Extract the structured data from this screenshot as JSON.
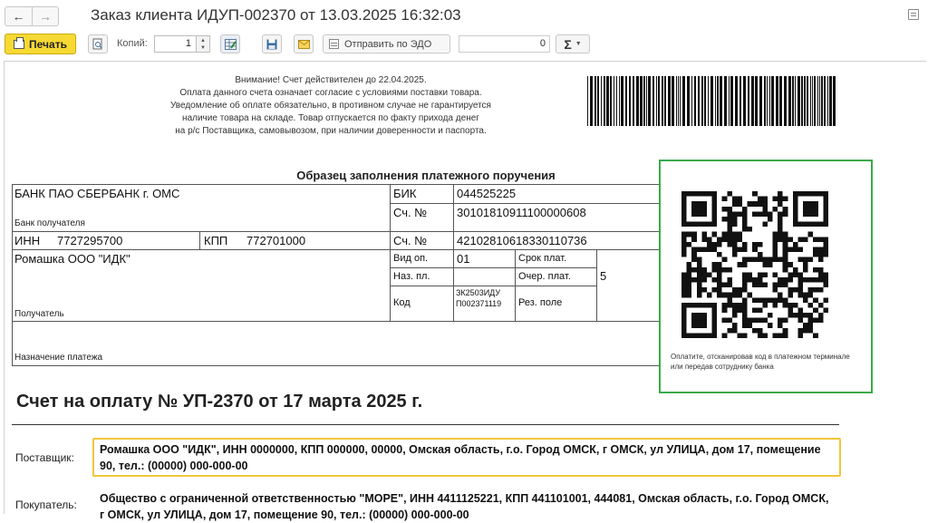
{
  "window": {
    "title": "Заказ клиента ИДУП-002370 от 13.03.2025 16:32:03"
  },
  "toolbar": {
    "print_label": "Печать",
    "copies_label": "Копий:",
    "copies_value": "1",
    "send_edo_label": "Отправить по ЭДО",
    "sum_value": "0",
    "sigma_label": "Σ"
  },
  "document": {
    "notice_lines": [
      "Внимание! Счет действителен до 22.04.2025.",
      "Оплата данного счета означает согласие с условиями поставки товара.",
      "Уведомление об оплате обязательно, в противном случае не гарантируется",
      "наличие товара на складе. Товар отпускается по факту прихода денег",
      "на р/с Поставщика, самовывозом, при наличии доверенности и паспорта."
    ],
    "payment_sample": {
      "title": "Образец заполнения платежного поручения",
      "bank_name": "БАНК ПАО СБЕРБАНК г. ОМС",
      "bank_label": "Банк получателя",
      "bik_label": "БИК",
      "bik": "044525225",
      "corr_label": "Сч. №",
      "corr_account": "30101810911100000608",
      "inn_label": "ИНН",
      "inn": "7727295700",
      "kpp_label": "КПП",
      "kpp": "772701000",
      "account_label": "Сч. №",
      "account": "42102810618330110736",
      "recipient_name": "Ромашка ООО \"ИДК\"",
      "recipient_label": "Получатель",
      "vid_op_label": "Вид оп.",
      "vid_op": "01",
      "srok_label": "Срок плат.",
      "naz_pl_label": "Наз. пл.",
      "ochered_label": "Очер. плат.",
      "ochered": "5",
      "kod_label": "Код",
      "kod": "ЗК2503ИДУ П002371119",
      "rez_label": "Рез. поле",
      "purpose_label": "Назначение платежа"
    },
    "qr_caption": "Оплатите, отсканировав код в платежном терминале или передав сотруднику банка",
    "invoice_title": "Счет на оплату № УП-2370 от 17 марта 2025 г.",
    "supplier_label": "Поставщик:",
    "supplier_text": "Ромашка ООО \"ИДК\", ИНН 0000000, КПП 000000, 00000, Омская область, г.о. Город ОМСК, г ОМСК, ул УЛИЦА, дом 17, помещение 90, тел.: (00000) 000-000-00",
    "buyer_label": "Покупатель:",
    "buyer_text": "Общество с ограниченной ответственностью \"МОРЕ\", ИНН 4411125221, КПП 441101001, 444081, Омская область, г.о. Город ОМСК, г ОМСК, ул УЛИЦА, дом 17, помещение 90, тел.: (00000) 000-000-00"
  },
  "colors": {
    "print_button": "#f6d932",
    "qr_frame": "#3aaa4a",
    "supplier_highlight": "#f2c63a"
  },
  "icons": {
    "back": "arrow-left-icon",
    "forward": "arrow-right-icon",
    "menu": "more-menu-icon",
    "printer": "printer-icon",
    "preview": "preview-icon",
    "edit": "edit-table-icon",
    "save": "save-disk-icon",
    "mail": "mail-icon",
    "edo": "edo-document-icon",
    "sigma": "sum-icon"
  }
}
